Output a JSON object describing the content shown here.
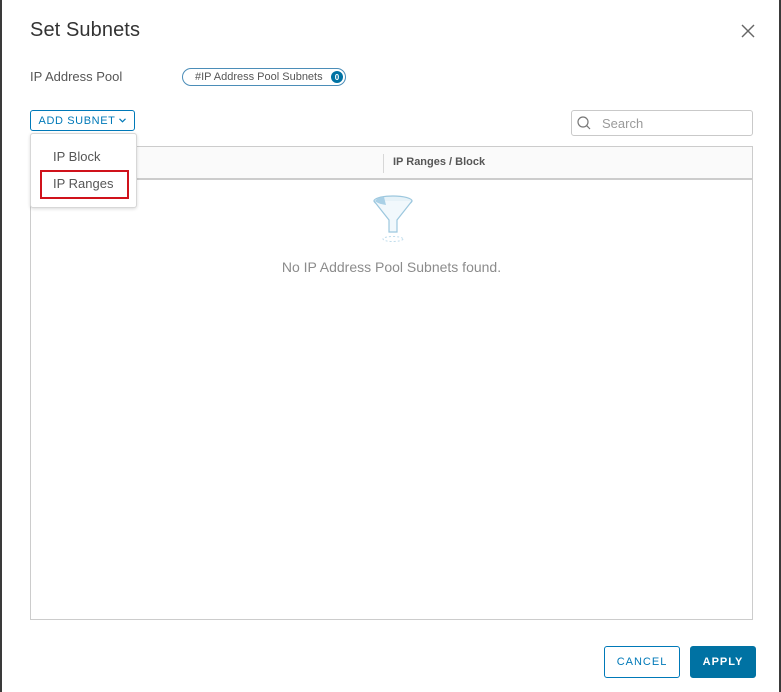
{
  "dialog": {
    "title": "Set Subnets",
    "close_icon": "close-icon"
  },
  "pool": {
    "label": "IP Address Pool",
    "pill_text": "#IP Address Pool Subnets",
    "pill_count": "0"
  },
  "toolbar": {
    "add_subnet_label": "ADD SUBNET",
    "add_subnet_chevron": "⌄",
    "search_placeholder": "Search",
    "search_value": ""
  },
  "dropdown": {
    "items": [
      {
        "label": "IP Block"
      },
      {
        "label": "IP Ranges",
        "highlighted": true
      }
    ],
    "highlight_color": "#d0121b"
  },
  "grid": {
    "columns": [
      {
        "title": ""
      },
      {
        "title": "IP Ranges / Block"
      }
    ],
    "rows": [],
    "empty_icon": "funnel-icon",
    "empty_message": "No IP Address Pool Subnets found."
  },
  "footer": {
    "cancel_label": "CANCEL",
    "apply_label": "APPLY"
  },
  "colors": {
    "accent": "#0079b8",
    "primary_button": "#0072a3",
    "text": "#565656"
  }
}
